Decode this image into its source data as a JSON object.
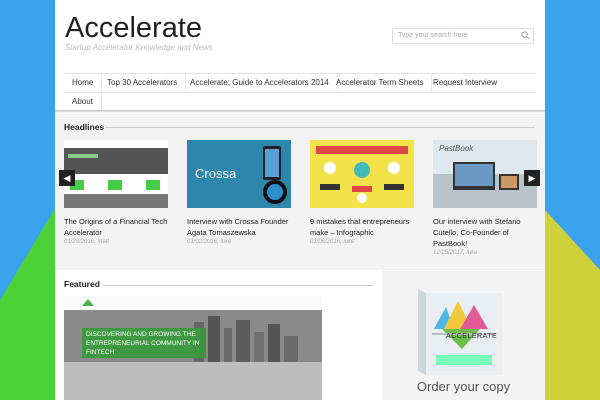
{
  "site": {
    "title": "Accelerate",
    "tagline": "Startup Accelerator Knowledge and News"
  },
  "search": {
    "placeholder": "Type your search here"
  },
  "nav": [
    "Home",
    "Top 30 Accelerators",
    "Accelerate: Guide to Accelerators 2014",
    "Accelerator Term Sheets",
    "Request Interview",
    "About"
  ],
  "headlines": {
    "heading": "Headlines",
    "prev": "◀",
    "next": "▶",
    "items": [
      {
        "title": "The Origins of a Financial Tech Accelerator",
        "meta": "01/29/2016, Matt",
        "thumb_text": ""
      },
      {
        "title": "Interview with Crossa Founder Agata Tomaszewska",
        "meta": "01/02/2016, luke",
        "thumb_text": "Crossa"
      },
      {
        "title": "9 mistakes that entrepreneurs make – Infographic",
        "meta": "01/06/2016, luke",
        "thumb_text": ""
      },
      {
        "title": "Our interview with Stefano Cutello, Co-Founder of PastBook!",
        "meta": "12/25/2017, luke",
        "thumb_text": "PastBook"
      }
    ]
  },
  "featured": {
    "heading": "Featured",
    "banner_text": "DISCOVERING AND GROWING THE ENTREPRENEURIAL COMMUNITY IN FINTECH"
  },
  "sidebar": {
    "book_title": "ACCELERATE",
    "order_text": "Order your copy"
  },
  "colors": {
    "background": "#3aa3ee",
    "green": "#4cd137",
    "yellow": "#cfd13a"
  }
}
